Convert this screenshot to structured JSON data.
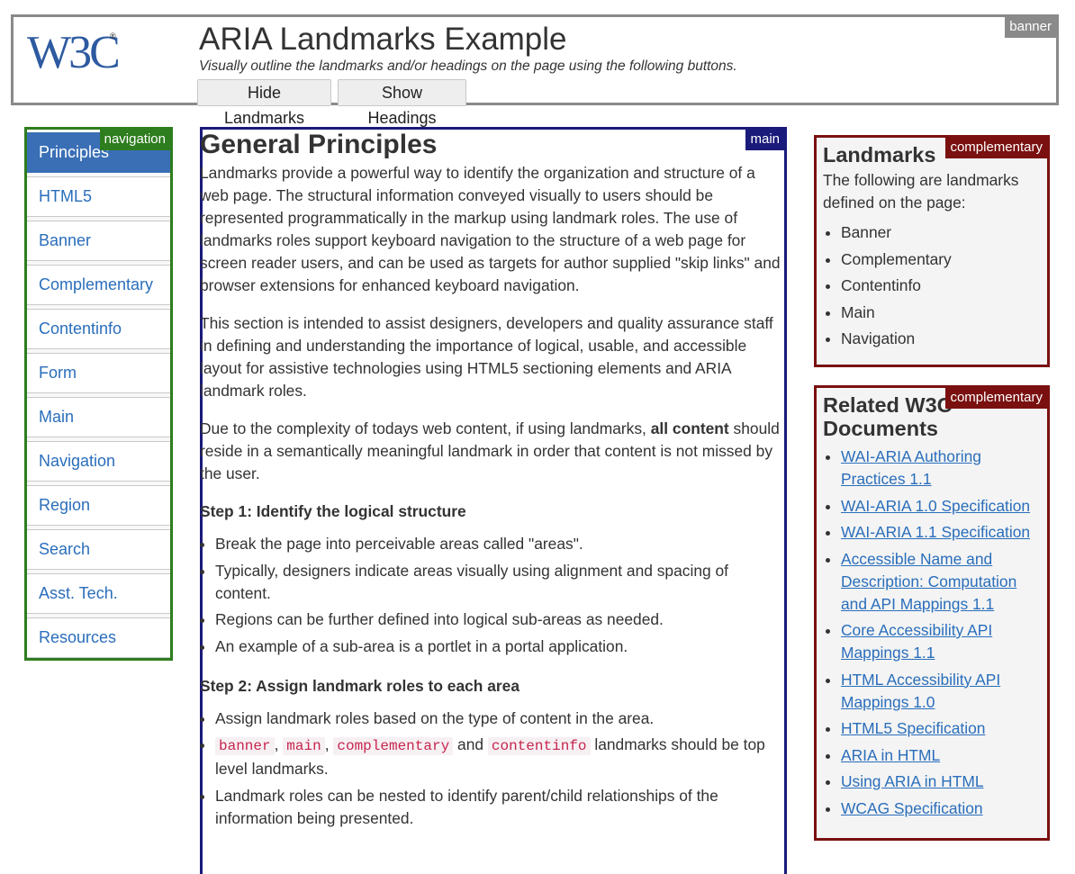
{
  "banner": {
    "landmark_label": "banner",
    "logo_text": "W3C",
    "title": "ARIA Landmarks Example",
    "subtitle": "Visually outline the landmarks and/or headings on the page using the following buttons.",
    "hide_landmarks_label": "Hide Landmarks",
    "show_headings_label": "Show Headings"
  },
  "navigation": {
    "landmark_label": "navigation",
    "items": [
      {
        "label": "Principles",
        "active": true
      },
      {
        "label": "HTML5"
      },
      {
        "label": "Banner"
      },
      {
        "label": "Complementary"
      },
      {
        "label": "Contentinfo"
      },
      {
        "label": "Form"
      },
      {
        "label": "Main"
      },
      {
        "label": "Navigation"
      },
      {
        "label": "Region"
      },
      {
        "label": "Search"
      },
      {
        "label": "Asst. Tech."
      },
      {
        "label": "Resources"
      }
    ]
  },
  "main": {
    "landmark_label": "main",
    "heading": "General Principles",
    "p1": "Landmarks provide a powerful way to identify the organization and structure of a web page. The structural information conveyed visually to users should be represented programmatically in the markup using landmark roles. The use of landmarks roles support keyboard navigation to the structure of a web page for screen reader users, and can be used as targets for author supplied \"skip links\" and browser extensions for enhanced keyboard navigation.",
    "p2": "This section is intended to assist designers, developers and quality assurance staff in defining and understanding the importance of logical, usable, and accessible layout for assistive technologies using HTML5 sectioning elements and ARIA landmark roles.",
    "p3_before": "Due to the complexity of todays web content, if using landmarks, ",
    "p3_bold": "all content",
    "p3_after": " should reside in a semantically meaningful landmark in order that content is not missed by the user.",
    "step1_heading": "Step 1: Identify the logical structure",
    "step1_items": [
      "Break the page into perceivable areas called \"areas\".",
      "Typically, designers indicate areas visually using alignment and spacing of content.",
      "Regions can be further defined into logical sub-areas as needed.",
      "An example of a sub-area is a portlet in a portal application."
    ],
    "step2_heading": "Step 2: Assign landmark roles to each area",
    "step2_item1": "Assign landmark roles based on the type of content in the area.",
    "step2_item2": {
      "code1": "banner",
      "sep1": ", ",
      "code2": "main",
      "sep2": ", ",
      "code3": "complementary",
      "sep3": " and ",
      "code4": "contentinfo",
      "tail": " landmarks should be top level landmarks."
    },
    "step2_item3": "Landmark roles can be nested to identify parent/child relationships of the information being presented."
  },
  "complementary_landmarks": {
    "landmark_label": "complementary",
    "heading": "Landmarks",
    "intro": "The following are landmarks defined on the page:",
    "items": [
      "Banner",
      "Complementary",
      "Contentinfo",
      "Main",
      "Navigation"
    ]
  },
  "complementary_related": {
    "landmark_label": "complementary",
    "heading": "Related W3C Documents",
    "links": [
      "WAI-ARIA Authoring Practices 1.1",
      "WAI-ARIA 1.0 Specification",
      "WAI-ARIA 1.1 Specification",
      "Accessible Name and Description: Computation and API Mappings 1.1",
      "Core Accessibility API Mappings 1.1",
      "HTML Accessibility API Mappings 1.0",
      "HTML5 Specification",
      "ARIA in HTML",
      "Using ARIA in HTML",
      "WCAG Specification"
    ]
  },
  "colors": {
    "banner_outline": "#8a8a8a",
    "navigation_outline": "#2e7d1e",
    "main_outline": "#1a1a7a",
    "complementary_outline": "#7a1010",
    "link": "#2a6ebb",
    "active_nav": "#3a6fb6"
  }
}
